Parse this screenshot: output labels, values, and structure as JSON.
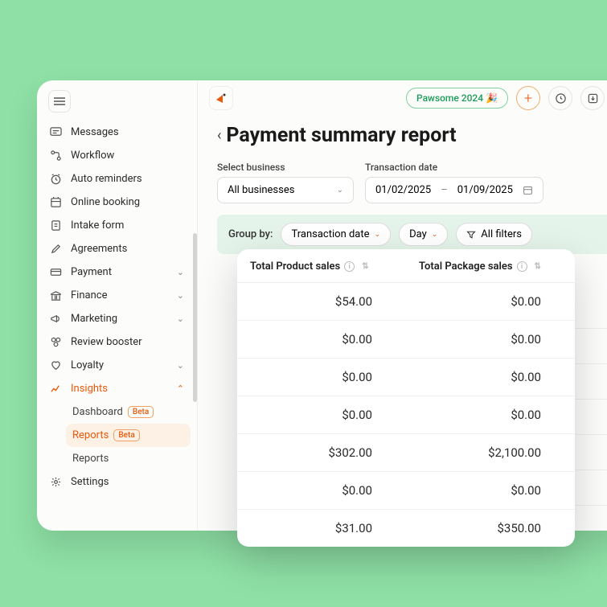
{
  "sidebar": {
    "items": [
      {
        "label": "Messages",
        "icon": "message"
      },
      {
        "label": "Workflow",
        "icon": "workflow"
      },
      {
        "label": "Auto reminders",
        "icon": "clock"
      },
      {
        "label": "Online booking",
        "icon": "booking"
      },
      {
        "label": "Intake form",
        "icon": "form"
      },
      {
        "label": "Agreements",
        "icon": "pencil"
      },
      {
        "label": "Payment",
        "icon": "card",
        "expandable": true
      },
      {
        "label": "Finance",
        "icon": "bank",
        "expandable": true
      },
      {
        "label": "Marketing",
        "icon": "megaphone",
        "expandable": true
      },
      {
        "label": "Review booster",
        "icon": "review"
      },
      {
        "label": "Loyalty",
        "icon": "heart",
        "expandable": true
      },
      {
        "label": "Insights",
        "icon": "chart",
        "expandable": true,
        "active": true
      }
    ],
    "insights_subitems": [
      {
        "label": "Dashboard",
        "badge": "Beta"
      },
      {
        "label": "Reports",
        "badge": "Beta",
        "highlight": true
      },
      {
        "label": "Reports"
      }
    ],
    "settings_label": "Settings"
  },
  "topbar": {
    "promo": "Pawsome 2024 🎉"
  },
  "page": {
    "title": "Payment summary report",
    "business_label": "Select business",
    "business_value": "All businesses",
    "date_label": "Transaction date",
    "date_from": "01/02/2025",
    "date_to": "01/09/2025",
    "group_by_label": "Group by:",
    "group_by_value": "Transaction date",
    "period_value": "Day",
    "all_filters": "All filters"
  },
  "table": {
    "col1": "Total Product sales",
    "col2": "Total Package sales",
    "rows": [
      {
        "product": "$54.00",
        "package": "$0.00"
      },
      {
        "product": "$0.00",
        "package": "$0.00"
      },
      {
        "product": "$0.00",
        "package": "$0.00"
      },
      {
        "product": "$0.00",
        "package": "$0.00"
      },
      {
        "product": "$302.00",
        "package": "$2,100.00"
      },
      {
        "product": "$0.00",
        "package": "$0.00"
      },
      {
        "product": "$31.00",
        "package": "$350.00"
      }
    ]
  }
}
